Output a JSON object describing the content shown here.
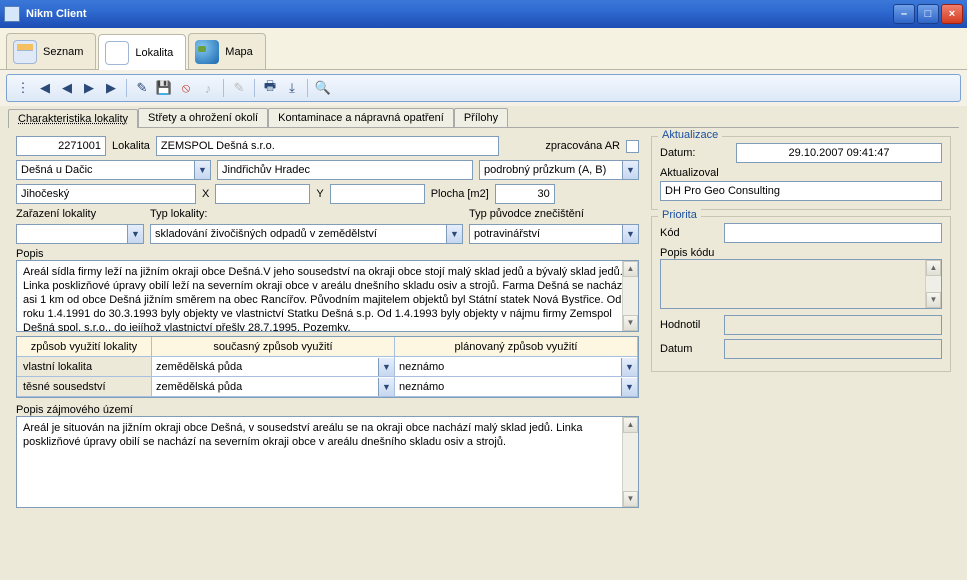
{
  "window": {
    "title": "Nikm Client"
  },
  "bigtabs": {
    "seznam": "Seznam",
    "lokalita": "Lokalita",
    "mapa": "Mapa"
  },
  "subtabs": {
    "char": "Charakteristika lokality",
    "strety": "Střety a ohrožení okolí",
    "kont": "Kontaminace a nápravná opatření",
    "prilohy": "Přílohy"
  },
  "form": {
    "id": "2271001",
    "lokalita_lbl": "Lokalita",
    "lokalita_val": "ZEMSPOL Dešná s.r.o.",
    "zpracovana_ar_lbl": "zpracována AR",
    "obec": "Dešná u Dačic",
    "okres": "Jindřichův Hradec",
    "pruzkum": "podrobný průzkum (A, B)",
    "kraj": "Jihočeský",
    "x_lbl": "X",
    "x_val": "",
    "y_lbl": "Y",
    "y_val": "",
    "plocha_lbl": "Plocha [m2]",
    "plocha_val": "30",
    "zarazeni_lbl": "Zařazení lokality",
    "zarazeni_val": "",
    "typ_lokality_lbl": "Typ lokality:",
    "typ_lokality_val": "skladování živočišných odpadů v zemědělství",
    "typ_puvodce_lbl": "Typ původce znečištění",
    "typ_puvodce_val": "potravinářství",
    "popis_lbl": "Popis",
    "popis_val": "Areál sídla firmy leží na jižním okraji obce Dešná.V jeho sousedství na okraji obce stojí malý sklad jedů a bývalý sklad jedů. Linka posklizňové úpravy obilí leží na severním okraji obce v areálu dnešního skladu osiv a strojů. Farma Dešná se nachází asi 1 km od obce Dešná jižním směrem na obec Rancířov. Původním majitelem objektů byl Státní statek Nová Bystřice. Od roku 1.4.1991 do 30.3.1993 byly objekty ve vlastnictví Statku Dešná s.p. Od 1.4.1993 byly objekty v nájmu firmy Zemspol Dešná spol. s.r.o., do jejíhož vlastnictví přešly 28.7.1995. Pozemky,",
    "table": {
      "h1": "způsob využití lokality",
      "h2": "současný způsob využití",
      "h3": "plánovaný způsob využití",
      "rows": [
        {
          "a": "vlastní lokalita",
          "b": "zemědělská půda",
          "c": "neznámo"
        },
        {
          "a": "těsné sousedství",
          "b": "zemědělská půda",
          "c": "neznámo"
        }
      ]
    },
    "popis_zaj_lbl": "Popis zájmového území",
    "popis_zaj_val": "Areál je situován na jižním okraji obce Dešná, v sousedství areálu se na okraji obce nachází malý sklad jedů. Linka posklizňové úpravy obilí se nachází na severním okraji obce v areálu dnešního skladu osiv a strojů."
  },
  "right": {
    "akt_legend": "Aktualizace",
    "datum_lbl": "Datum:",
    "datum_val": "29.10.2007 09:41:47",
    "aktualizoval_lbl": "Aktualizoval",
    "aktualizoval_val": "DH Pro Geo Consulting",
    "prio_legend": "Priorita",
    "kod_lbl": "Kód",
    "popis_kodu_lbl": "Popis kódu",
    "hodnotil_lbl": "Hodnotil",
    "datum2_lbl": "Datum"
  }
}
